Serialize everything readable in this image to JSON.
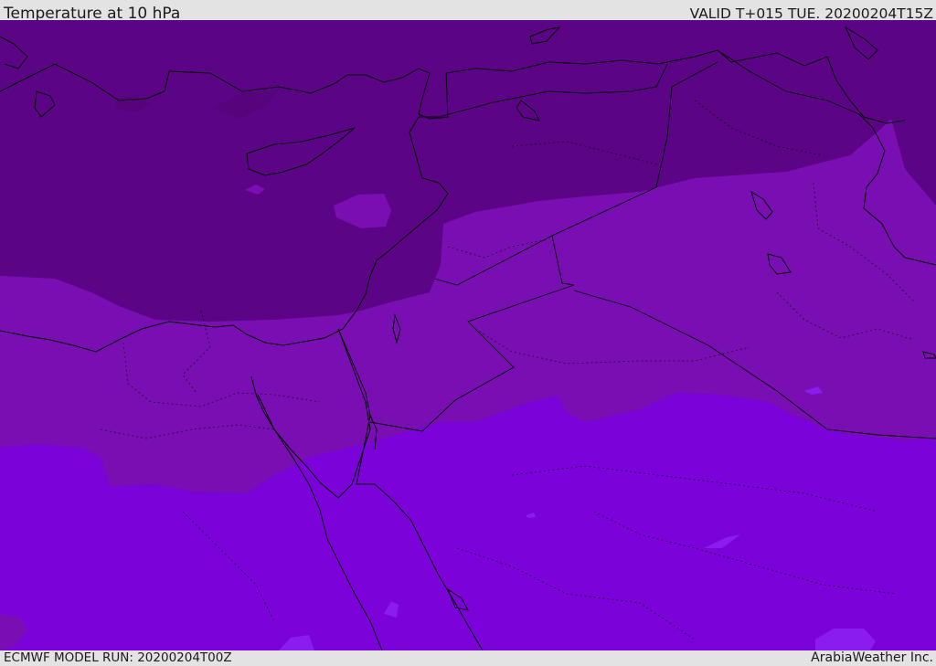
{
  "header": {
    "title": "Temperature at 10 hPa",
    "valid": "VALID T+015 TUE. 20200204T15Z"
  },
  "footer": {
    "model_run": "ECMWF MODEL RUN: 20200204T00Z",
    "credit": "ArabiaWeather Inc."
  },
  "map": {
    "colors": {
      "band_darkest": "#5c0486",
      "band_dark": "#6a049a",
      "band_mid": "#790fb2",
      "band_light": "#7b02d8",
      "band_lightest": "#8a1cf0",
      "coastline": "#000000"
    }
  }
}
